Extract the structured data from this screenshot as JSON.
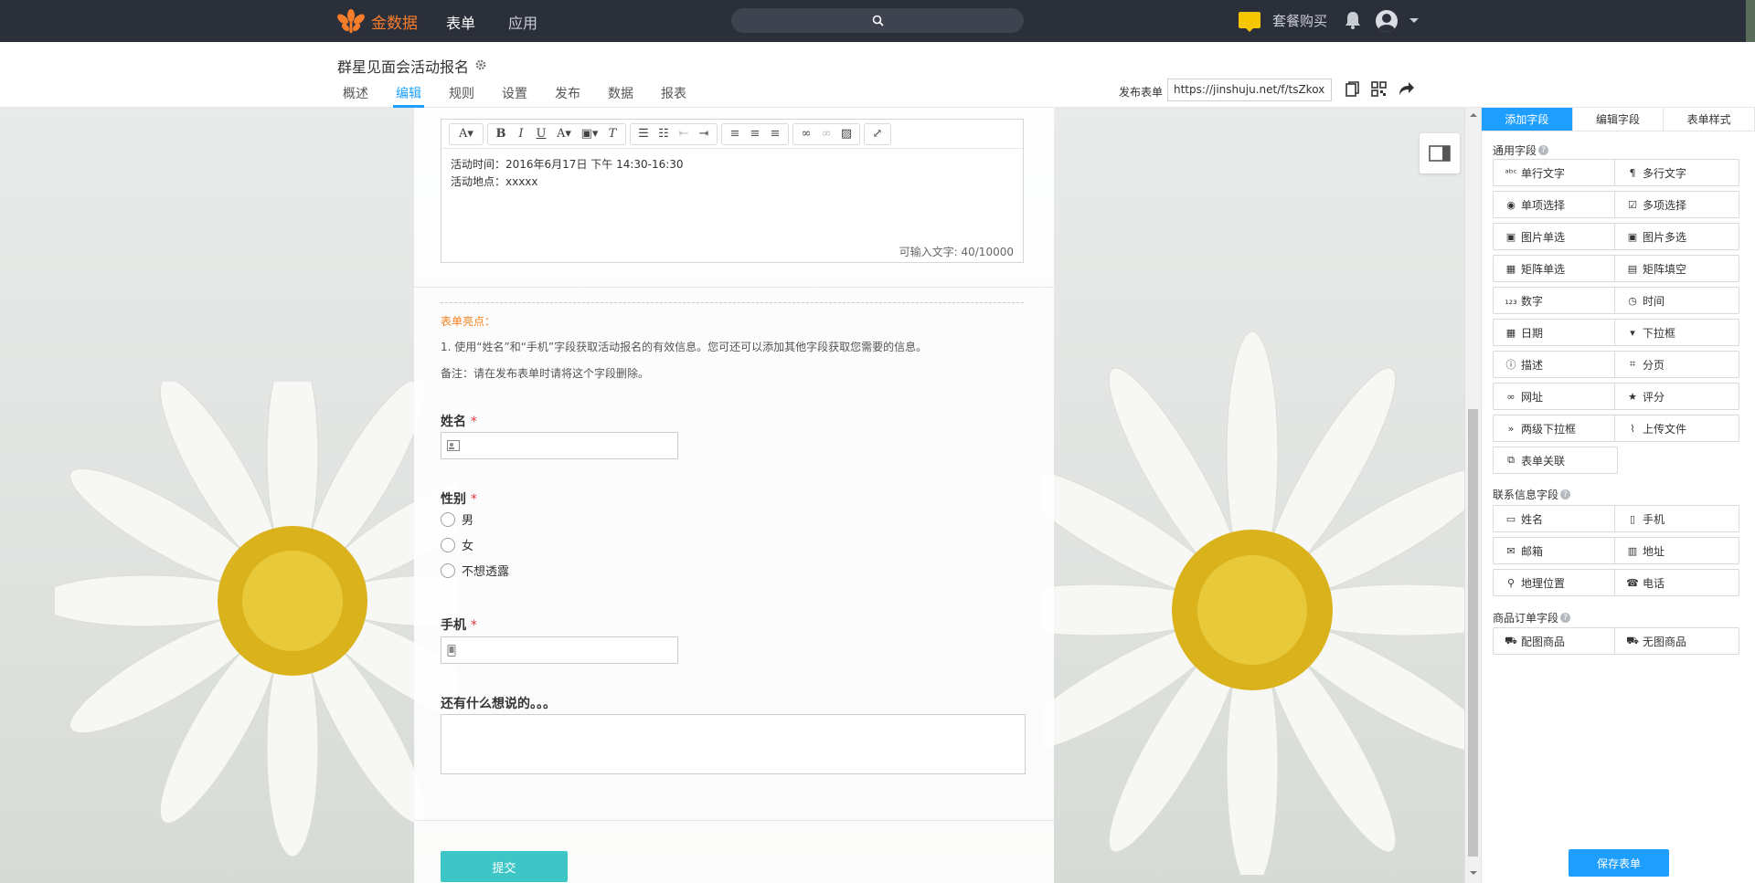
{
  "topbar": {
    "logo_text": "金数据",
    "nav": [
      "表单",
      "应用"
    ],
    "buy_label": "套餐购买"
  },
  "form": {
    "title": "群星见面会活动报名",
    "tabs": [
      "概述",
      "编辑",
      "规则",
      "设置",
      "发布",
      "数据",
      "报表"
    ],
    "active_tab": "编辑",
    "publish_label": "发布表单",
    "publish_url": "https://jinshuju.net/f/tsZkox"
  },
  "editor": {
    "lines": [
      "活动时间：2016年6月17日 下午 14:30-16:30",
      "活动地点：xxxxx"
    ],
    "counter": "可输入文字: 40/10000"
  },
  "highlights": {
    "title": "表单亮点：",
    "line1": "1. 使用“姓名”和“手机”字段获取活动报名的有效信息。您可还可以添加其他字段获取您需要的信息。",
    "line2": "备注：请在发布表单时请将这个字段删除。"
  },
  "fields": {
    "name_label": "姓名",
    "gender_label": "性别",
    "gender_options": [
      "男",
      "女",
      "不想透露"
    ],
    "phone_label": "手机",
    "comment_label": "还有什么想说的。。。",
    "required_mark": "*",
    "submit_label": "提交"
  },
  "panel": {
    "tabs": [
      "添加字段",
      "编辑字段",
      "表单样式"
    ],
    "general_title": "通用字段",
    "general_fields": [
      {
        "label": "单行文字",
        "icon": "abc-icon"
      },
      {
        "label": "多行文字",
        "icon": "paragraph-icon"
      },
      {
        "label": "单项选择",
        "icon": "radio-icon"
      },
      {
        "label": "多项选择",
        "icon": "checkbox-icon"
      },
      {
        "label": "图片单选",
        "icon": "image-radio-icon"
      },
      {
        "label": "图片多选",
        "icon": "image-checkbox-icon"
      },
      {
        "label": "矩阵单选",
        "icon": "matrix-icon"
      },
      {
        "label": "矩阵填空",
        "icon": "matrix-fill-icon"
      },
      {
        "label": "数字",
        "icon": "number-icon"
      },
      {
        "label": "时间",
        "icon": "clock-icon"
      },
      {
        "label": "日期",
        "icon": "calendar-icon"
      },
      {
        "label": "下拉框",
        "icon": "dropdown-icon"
      },
      {
        "label": "描述",
        "icon": "info-icon"
      },
      {
        "label": "分页",
        "icon": "page-break-icon"
      },
      {
        "label": "网址",
        "icon": "link-icon"
      },
      {
        "label": "评分",
        "icon": "star-icon"
      },
      {
        "label": "两级下拉框",
        "icon": "double-chevron-icon"
      },
      {
        "label": "上传文件",
        "icon": "paperclip-icon"
      },
      {
        "label": "表单关联",
        "icon": "form-link-icon"
      }
    ],
    "contact_title": "联系信息字段",
    "contact_fields": [
      {
        "label": "姓名",
        "icon": "id-card-icon"
      },
      {
        "label": "手机",
        "icon": "mobile-icon"
      },
      {
        "label": "邮箱",
        "icon": "mail-icon"
      },
      {
        "label": "地址",
        "icon": "building-icon"
      },
      {
        "label": "地理位置",
        "icon": "pin-icon"
      },
      {
        "label": "电话",
        "icon": "phone-icon"
      }
    ],
    "goods_title": "商品订单字段",
    "goods_fields": [
      {
        "label": "配图商品",
        "icon": "cart-icon"
      },
      {
        "label": "无图商品",
        "icon": "cart-plain-icon"
      }
    ],
    "save_label": "保存表单"
  },
  "colors": {
    "accent": "#1e9fff",
    "brand": "#f77d2b",
    "submit": "#3ec6c6",
    "required": "#e5383b",
    "topbar": "#2b2f3a"
  }
}
